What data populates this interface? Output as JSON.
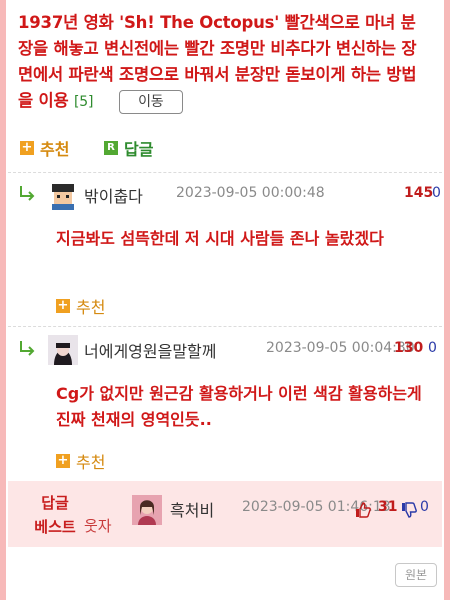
{
  "post": {
    "title": "1937년 영화 'Sh! The Octopus' 빨간색으로 마녀 분장을 해놓고 변신전에는 빨간 조명만 비추다가 변신하는 장면에서 파란색 조명으로 바꿔서 분장만 돋보이게 하는 방법을 이용",
    "reply_count": "[5]",
    "move_label": "이동"
  },
  "actions": {
    "recommend_icon": "+",
    "recommend_label": "추천",
    "reply_icon": "R",
    "reply_label": "답글"
  },
  "comments": [
    {
      "nickname": "밖이춥다",
      "date": "2023-09-05 00:00:48",
      "likes": "145",
      "dislikes": "0",
      "text": "지금봐도 섬뜩한데 저 시대 사람들 존나 놀랐겠다",
      "recommend_label": "추천",
      "recommend_icon": "+"
    },
    {
      "nickname": "너에게영원을말할께",
      "date": "2023-09-05 00:04:30",
      "likes": "130",
      "dislikes": "0",
      "text": "Cg가 없지만 원근감 활용하거나 이런 색감 활용하는게 진짜 천재의 영역인듯..",
      "recommend_label": "추천",
      "recommend_icon": "+"
    }
  ],
  "best": {
    "label_line1": "답글",
    "label_line2": "베스트",
    "sub": "웃자",
    "nickname": "흑처비",
    "date": "2023-09-05 01:46:13",
    "likes": "31",
    "dislikes": "0"
  },
  "footer": {
    "original_label": "원본"
  },
  "colors": {
    "frame": "#f7b9b9",
    "title_red": "#d01818",
    "reply_green": "#2e8b2e",
    "recommend_orange": "#d58a10",
    "best_bg": "#fde6e6"
  }
}
